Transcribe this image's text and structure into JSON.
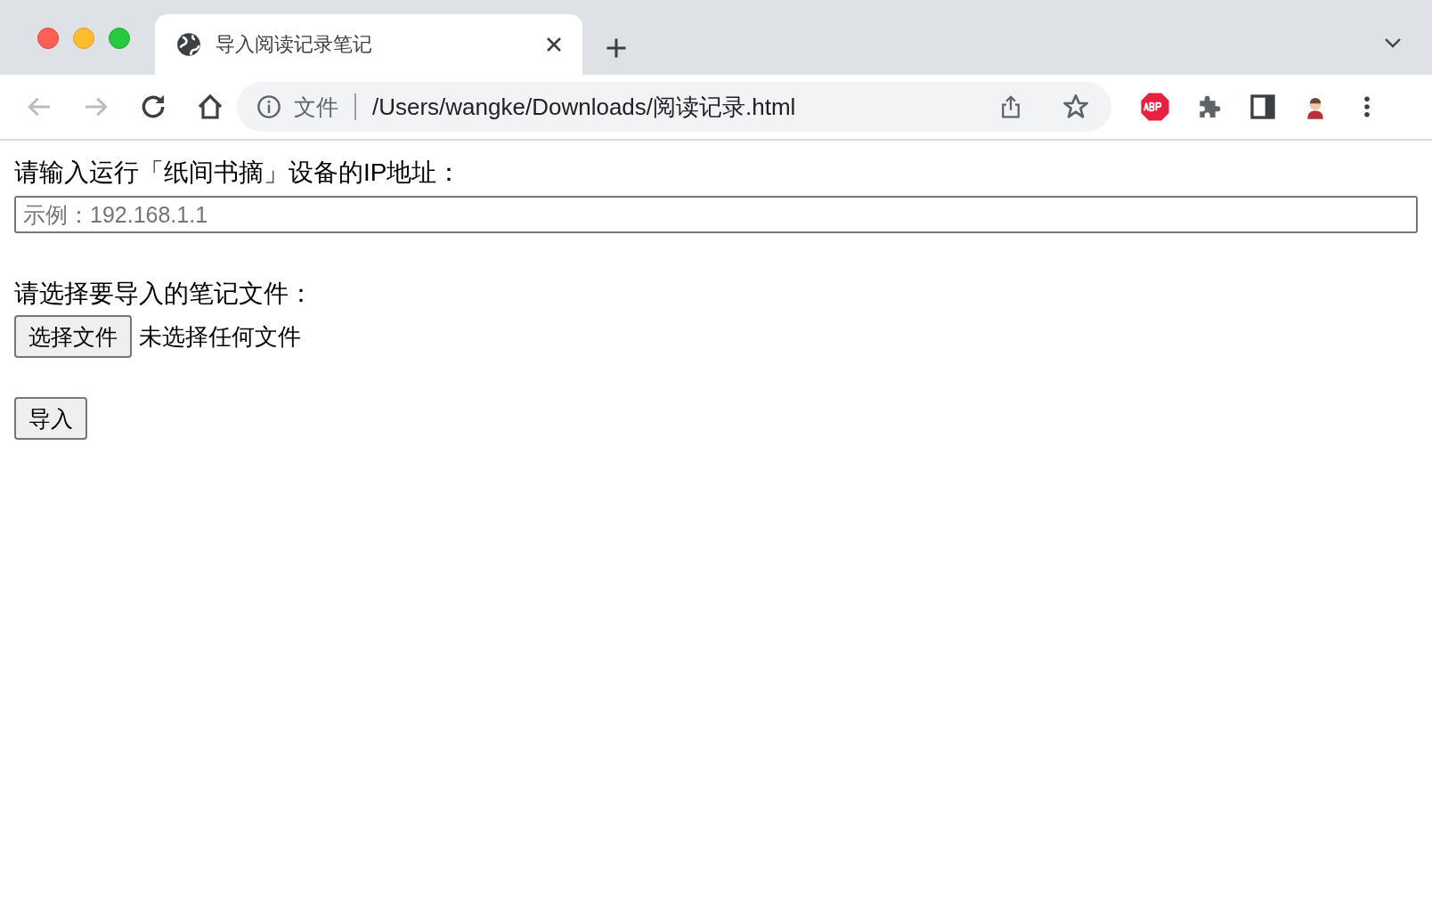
{
  "tabs": [
    {
      "title": "导入阅读记录笔记",
      "selected": true
    }
  ],
  "nav_buttons": [
    {
      "kind": "back",
      "disabled": true
    },
    {
      "kind": "forward",
      "disabled": true
    },
    {
      "kind": "reload",
      "disabled": false
    },
    {
      "kind": "home",
      "disabled": false
    }
  ],
  "address_bar": {
    "security_label": "文件",
    "url": "/Users/wangke/Downloads/阅读记录.html"
  },
  "page": {
    "ip_label": "请输入运行「纸间书摘」设备的IP地址：",
    "ip_input": {
      "placeholder": "示例：192.168.1.1"
    },
    "file_label": "请选择要导入的笔记文件：",
    "file_button": "选择文件",
    "file_status": "未选择任何文件",
    "submit_button": "导入"
  }
}
